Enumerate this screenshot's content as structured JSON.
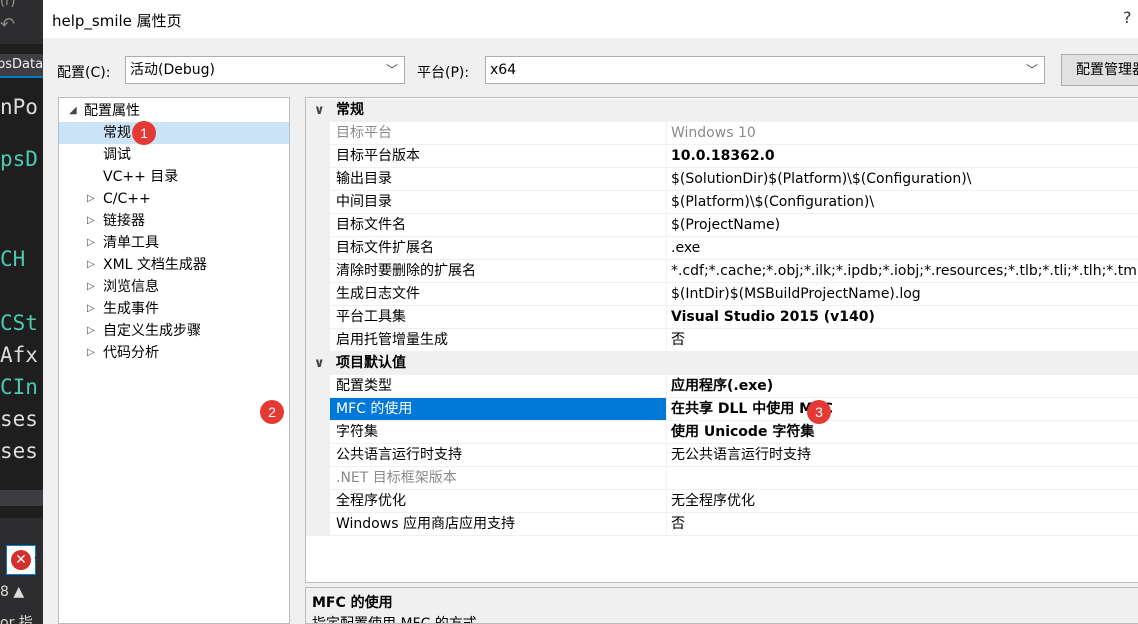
{
  "ide": {
    "top_text": "(r)",
    "tab_label": "psData",
    "code_lines": [
      {
        "text": "nPo",
        "color": "#dcdcdc"
      },
      {
        "text": "",
        "color": "#dcdcdc"
      },
      {
        "text": "psD",
        "color": "#4ec9b0"
      },
      {
        "text": "",
        "color": "#dcdcdc"
      },
      {
        "text": "",
        "color": "#dcdcdc"
      },
      {
        "text": " CH",
        "color": "#4ec9b0"
      },
      {
        "text": "",
        "color": "#dcdcdc"
      },
      {
        "text": "CSt",
        "color": "#4ec9b0"
      },
      {
        "text": "Afx",
        "color": "#dcdcdc"
      },
      {
        "text": "CIn",
        "color": "#4ec9b0"
      },
      {
        "text": "ses",
        "color": "#dcdcdc"
      },
      {
        "text": "ses",
        "color": "#dcdcdc"
      }
    ],
    "error_label": "错",
    "bottom_text_1": "8 ▲",
    "bottom_text_2": "or 指"
  },
  "dialog": {
    "title": "help_smile 属性页",
    "help_label": "?",
    "config_label": "配置(C):",
    "config_value": "活动(Debug)",
    "platform_label": "平台(P):",
    "platform_value": "x64",
    "config_manager_label": "配置管理器"
  },
  "tree": {
    "root": "配置属性",
    "items": [
      {
        "label": "常规",
        "expandable": false,
        "selected": true
      },
      {
        "label": "调试",
        "expandable": false,
        "selected": false
      },
      {
        "label": "VC++ 目录",
        "expandable": false,
        "selected": false
      },
      {
        "label": "C/C++",
        "expandable": true,
        "selected": false
      },
      {
        "label": "链接器",
        "expandable": true,
        "selected": false
      },
      {
        "label": "清单工具",
        "expandable": true,
        "selected": false
      },
      {
        "label": "XML 文档生成器",
        "expandable": true,
        "selected": false
      },
      {
        "label": "浏览信息",
        "expandable": true,
        "selected": false
      },
      {
        "label": "生成事件",
        "expandable": true,
        "selected": false
      },
      {
        "label": "自定义生成步骤",
        "expandable": true,
        "selected": false
      },
      {
        "label": "代码分析",
        "expandable": true,
        "selected": false
      }
    ]
  },
  "grid": {
    "categories": [
      {
        "label": "常规",
        "rows": [
          {
            "name": "目标平台",
            "value": "Windows 10",
            "disabled": true,
            "bold": false
          },
          {
            "name": "目标平台版本",
            "value": "10.0.18362.0",
            "disabled": false,
            "bold": true
          },
          {
            "name": "输出目录",
            "value": "$(SolutionDir)$(Platform)\\$(Configuration)\\",
            "disabled": false,
            "bold": false
          },
          {
            "name": "中间目录",
            "value": "$(Platform)\\$(Configuration)\\",
            "disabled": false,
            "bold": false
          },
          {
            "name": "目标文件名",
            "value": "$(ProjectName)",
            "disabled": false,
            "bold": false
          },
          {
            "name": "目标文件扩展名",
            "value": ".exe",
            "disabled": false,
            "bold": false
          },
          {
            "name": "清除时要删除的扩展名",
            "value": "*.cdf;*.cache;*.obj;*.ilk;*.ipdb;*.iobj;*.resources;*.tlb;*.tli;*.tlh;*.tm",
            "disabled": false,
            "bold": false
          },
          {
            "name": "生成日志文件",
            "value": "$(IntDir)$(MSBuildProjectName).log",
            "disabled": false,
            "bold": false
          },
          {
            "name": "平台工具集",
            "value": "Visual Studio 2015 (v140)",
            "disabled": false,
            "bold": true
          },
          {
            "name": "启用托管增量生成",
            "value": "否",
            "disabled": false,
            "bold": false
          }
        ]
      },
      {
        "label": "项目默认值",
        "rows": [
          {
            "name": "配置类型",
            "value": "应用程序(.exe)",
            "disabled": false,
            "bold": true
          },
          {
            "name": "MFC 的使用",
            "value": "在共享 DLL 中使用 MFC",
            "disabled": false,
            "bold": true,
            "selected": true
          },
          {
            "name": "字符集",
            "value": "使用 Unicode 字符集",
            "disabled": false,
            "bold": true
          },
          {
            "name": "公共语言运行时支持",
            "value": "无公共语言运行时支持",
            "disabled": false,
            "bold": false
          },
          {
            "name": ".NET 目标框架版本",
            "value": "",
            "disabled": true,
            "bold": false
          },
          {
            "name": "全程序优化",
            "value": "无全程序优化",
            "disabled": false,
            "bold": false
          },
          {
            "name": "Windows 应用商店应用支持",
            "value": "否",
            "disabled": false,
            "bold": false
          }
        ]
      }
    ]
  },
  "description": {
    "title": "MFC 的使用",
    "text": "指定配置使用 MFC 的方式。"
  },
  "markers": [
    "1",
    "2",
    "3"
  ],
  "colors": {
    "selection": "#0078d7",
    "tree_selection": "#cce4f7",
    "marker": "#e53935"
  }
}
